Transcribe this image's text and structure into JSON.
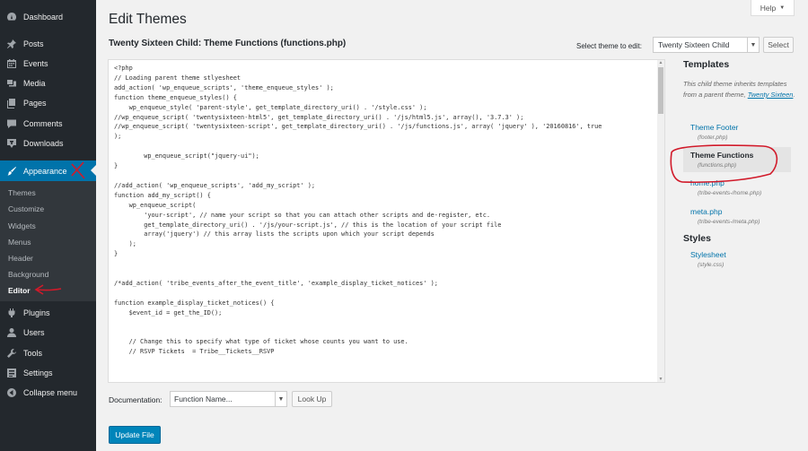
{
  "sidebar": {
    "dashboard": "Dashboard",
    "posts": "Posts",
    "events": "Events",
    "media": "Media",
    "pages": "Pages",
    "comments": "Comments",
    "downloads": "Downloads",
    "appearance": "Appearance",
    "submenu": [
      "Themes",
      "Customize",
      "Widgets",
      "Menus",
      "Header",
      "Background",
      "Editor"
    ],
    "plugins": "Plugins",
    "users": "Users",
    "tools": "Tools",
    "settings": "Settings",
    "collapse": "Collapse menu"
  },
  "header": {
    "help": "Help",
    "title": "Edit Themes",
    "file_title": "Twenty Sixteen Child: Theme Functions (functions.php)",
    "select_label": "Select theme to edit:",
    "selected_theme": "Twenty Sixteen Child",
    "select_button": "Select"
  },
  "editor": {
    "code": "<?php\n// Loading parent theme stlyesheet\nadd_action( 'wp_enqueue_scripts', 'theme_enqueue_styles' );\nfunction theme_enqueue_styles() {\n    wp_enqueue_style( 'parent-style', get_template_directory_uri() . '/style.css' );\n//wp_enqueue_script( 'twentysixteen-html5', get_template_directory_uri() . '/js/html5.js', array(), '3.7.3' );\n//wp_enqueue_script( 'twentysixteen-script', get_template_directory_uri() . '/js/functions.js', array( 'jquery' ), '20160816', true\n);\n\n        wp_enqueue_script(\"jquery-ui\");\n}\n\n//add_action( 'wp_enqueue_scripts', 'add_my_script' );\nfunction add_my_script() {\n    wp_enqueue_script(\n        'your-script', // name your script so that you can attach other scripts and de-register, etc.\n        get_template_directory_uri() . '/js/your-script.js', // this is the location of your script file\n        array('jquery') // this array lists the scripts upon which your script depends\n    );\n}\n\n\n/*add_action( 'tribe_events_after_the_event_title', 'example_display_ticket_notices' );\n\nfunction example_display_ticket_notices() {\n    $event_id = get_the_ID();\n\n\n    // Change this to specify what type of ticket whose counts you want to use.\n    // RSVP Tickets  = Tribe__Tickets__RSVP"
  },
  "templates": {
    "heading": "Templates",
    "inherits_text": "This child theme inherits templates from a parent theme,",
    "parent_link": "Twenty Sixteen",
    "period": ".",
    "items": [
      {
        "name": "Theme Footer",
        "file": "(footer.php)"
      },
      {
        "name": "Theme Functions",
        "file": "(functions.php)"
      },
      {
        "name": "home.php",
        "file": "(tribe-events-/home.php)"
      },
      {
        "name": "meta.php",
        "file": "(tribe-events-/meta.php)"
      }
    ],
    "styles_heading": "Styles",
    "styles": [
      {
        "name": "Stylesheet",
        "file": "(style.css)"
      }
    ]
  },
  "bottom": {
    "doc_label": "Documentation:",
    "doc_select": "Function Name...",
    "lookup": "Look Up",
    "update": "Update File"
  },
  "colors": {
    "sidebar_bg": "#23282d",
    "active_bg": "#0073aa",
    "annotation": "#d11a2a"
  }
}
